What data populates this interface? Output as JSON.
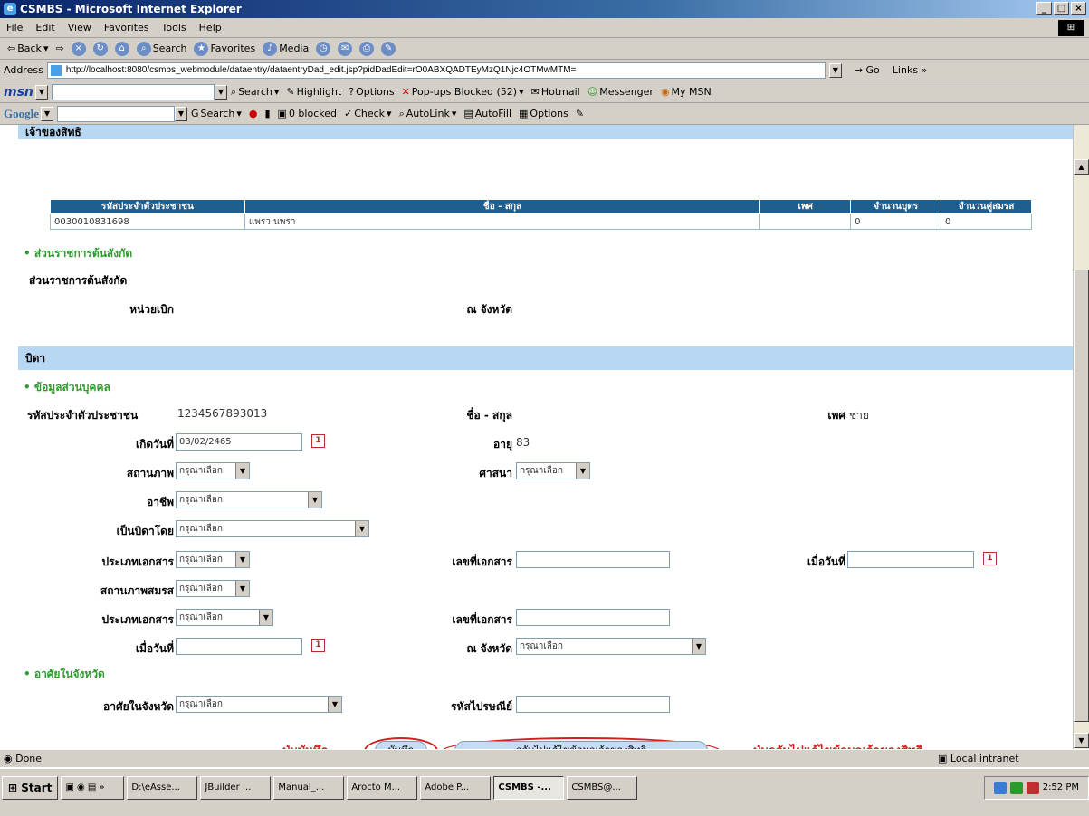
{
  "window": {
    "title": "CSMBS - Microsoft Internet Explorer"
  },
  "menu": [
    "File",
    "Edit",
    "View",
    "Favorites",
    "Tools",
    "Help"
  ],
  "toolbar": {
    "back": "Back",
    "search": "Search",
    "favorites": "Favorites",
    "media": "Media"
  },
  "address": {
    "label": "Address",
    "url": "http://localhost:8080/csmbs_webmodule/dataentry/dataentryDad_edit.jsp?pidDadEdit=rO0ABXQADTEyMzQ1Njc4OTMwMTM=",
    "go": "Go",
    "links": "Links »"
  },
  "msnbar": {
    "logo": "msn",
    "search": "Search",
    "highlight": "Highlight",
    "options": "Options",
    "popups": "Pop-ups Blocked (52)",
    "hotmail": "Hotmail",
    "messenger": "Messenger",
    "mymsn": "My MSN"
  },
  "googlebar": {
    "logo": "Google",
    "search": "Search",
    "blocked": "0 blocked",
    "check": "Check",
    "autolink": "AutoLink",
    "autofill": "AutoFill",
    "options": "Options"
  },
  "content": {
    "owner_section": "เจ้าของสิทธิ",
    "owner_table": {
      "headers": [
        "รหัสประจำตัวประชาชน",
        "ชื่อ - สกุล",
        "เพศ",
        "จำนวนบุตร",
        "จำนวนคู่สมรส"
      ],
      "row": [
        "0030010831698",
        "แพรว นพรา",
        "",
        "0",
        "0"
      ]
    },
    "org_bullet": "ส่วนราชการต้นสังกัด",
    "org_label": "ส่วนราชการต้นสังกัด",
    "disburse_label": "หน่วยเบิก",
    "province_label": "ณ จังหวัด",
    "father_section": "บิดา",
    "personal_bullet": "ข้อมูลส่วนบุคคล",
    "pid_label": "รหัสประจำตัวประชาชน",
    "pid_value": "1234567893013",
    "name_label": "ชื่อ - สกุล",
    "gender_label": "เพศ",
    "gender_value": "ชาย",
    "birth_label": "เกิดวันที่",
    "birth_value": "03/02/2465",
    "age_label": "อายุ",
    "age_value": "83",
    "status_label": "สถานภาพ",
    "religion_label": "ศาสนา",
    "career_label": "อาชีพ",
    "father_by_label": "เป็นบิดาโดย",
    "doctype_label": "ประเภทเอกสาร",
    "docno_label": "เลขที่เอกสาร",
    "date_label": "เมื่อวันที่",
    "marital_label": "สถานภาพสมรส",
    "doctype2_label": "ประเภทเอกสาร",
    "docno2_label": "เลขที่เอกสาร",
    "date2_label": "เมื่อวันที่",
    "province2_label": "ณ จังหวัด",
    "reside_bullet": "อาศัยในจังหวัด",
    "reside_label": "อาศัยในจังหวัด",
    "zip_label": "รหัสไปรษณีย์",
    "select_default": "กรุณาเลือก",
    "save_button": "บันทึก",
    "back_button": "กลับไปแก้ไขข้อมูลเจ้าของสิทธิ",
    "annot_save": "ปุ่มบันทึก",
    "annot_back": "ปุ่มกลับไปแก้ไขข้อมูลเจ้าของสิทธิ"
  },
  "status": {
    "left": "Done",
    "zone": "Local intranet"
  },
  "taskbar": {
    "start": "Start",
    "items": [
      "D:\\eAsse...",
      "JBuilder ...",
      "Manual_...",
      "Arocto M...",
      "Adobe P...",
      "CSMBS -...",
      "CSMBS@..."
    ],
    "clock": "2:52 PM"
  }
}
